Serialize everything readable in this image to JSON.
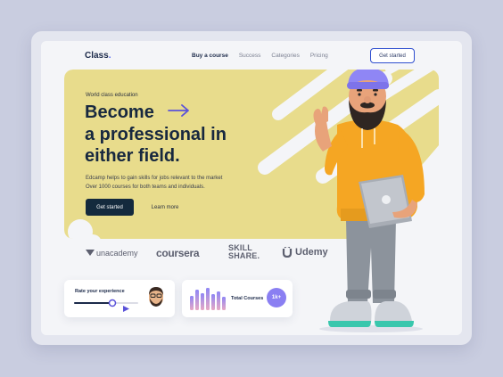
{
  "nav": {
    "logo": "Class",
    "logo_dot": ".",
    "links": [
      {
        "label": "Buy a course",
        "active": true
      },
      {
        "label": "Success",
        "active": false
      },
      {
        "label": "Categories",
        "active": false
      },
      {
        "label": "Pricing",
        "active": false
      }
    ],
    "cta_label": "Get started"
  },
  "hero": {
    "eyebrow": "World class education",
    "headline_line1": "Become",
    "headline_line2": "a professional in",
    "headline_line3": "either field.",
    "description_line1": "Edcamp helps to gain skills for jobs relevant to the market",
    "description_line2": "Over 1000 courses for both teams and individuals.",
    "primary_button": "Get started",
    "secondary_button": "Learn more"
  },
  "brands": {
    "unacademy": "unacademy",
    "coursera": "coursera",
    "skillshare_line1": "SKILL",
    "skillshare_line2": "SHARE.",
    "udemy": "Udemy"
  },
  "cards": {
    "rate_label": "Rate your experience",
    "rating_fraction": 0.6,
    "courses_label": "Total Courses",
    "courses_badge": "1k+"
  },
  "colors": {
    "accent_yellow": "#e8dc8c",
    "navy": "#142a3d",
    "purple": "#8a7ff2",
    "link_blue": "#2f4fcf"
  },
  "icons": {
    "arrow": "arrow-right-icon",
    "unacademy_mark": "unacademy-logo-icon",
    "udemy_mark": "udemy-logo-icon",
    "avatar": "avatar-icon",
    "play": "play-icon"
  }
}
